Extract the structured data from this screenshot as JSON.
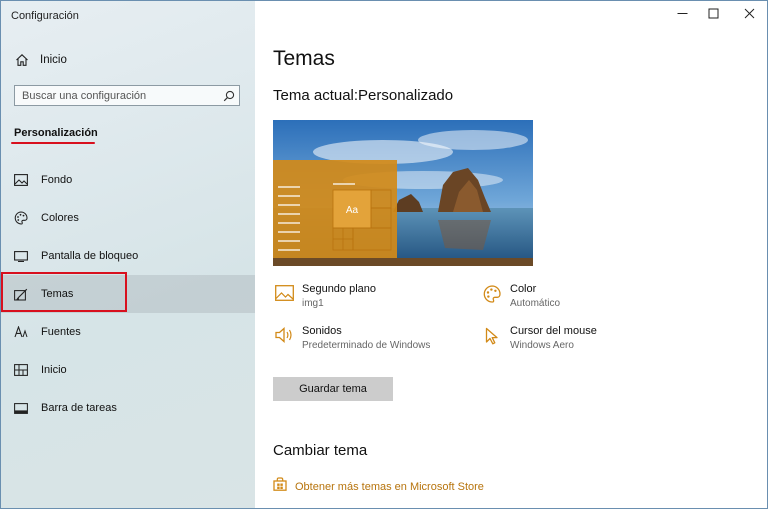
{
  "window": {
    "title": "Configuración",
    "minimize_icon": "minimize-icon",
    "maximize_icon": "maximize-icon",
    "close_icon": "close-icon"
  },
  "sidebar": {
    "home": {
      "label": "Inicio",
      "icon": "home-icon"
    },
    "search": {
      "placeholder": "Buscar una configuración",
      "icon": "search-icon"
    },
    "section": "Personalización",
    "items": [
      {
        "label": "Fondo",
        "icon": "image-icon",
        "active": false
      },
      {
        "label": "Colores",
        "icon": "palette-icon",
        "active": false
      },
      {
        "label": "Pantalla de bloqueo",
        "icon": "lock-screen-icon",
        "active": false
      },
      {
        "label": "Temas",
        "icon": "themes-brush-icon",
        "active": true
      },
      {
        "label": "Fuentes",
        "icon": "font-icon",
        "active": false
      },
      {
        "label": "Inicio",
        "icon": "start-tiles-icon",
        "active": false
      },
      {
        "label": "Barra de tareas",
        "icon": "taskbar-icon",
        "active": false
      }
    ]
  },
  "main": {
    "title": "Temas",
    "current_theme": "Tema actual:Personalizado",
    "preview": {
      "tile_label": "Aa",
      "accent": "#d28a18"
    },
    "properties": [
      {
        "title": "Segundo plano",
        "value": "img1",
        "icon": "image-icon"
      },
      {
        "title": "Color",
        "value": "Automático",
        "icon": "palette-icon"
      },
      {
        "title": "Sonidos",
        "value": "Predeterminado de Windows",
        "icon": "speaker-icon"
      },
      {
        "title": "Cursor del mouse",
        "value": "Windows Aero",
        "icon": "cursor-icon"
      }
    ],
    "save_button": "Guardar tema",
    "change_heading": "Cambiar tema",
    "store_link": {
      "label": "Obtener más temas en Microsoft Store",
      "icon": "store-bag-icon"
    }
  },
  "colors": {
    "accent": "#d28a18",
    "highlight_red": "#d8101e",
    "link": "#b7740d"
  }
}
